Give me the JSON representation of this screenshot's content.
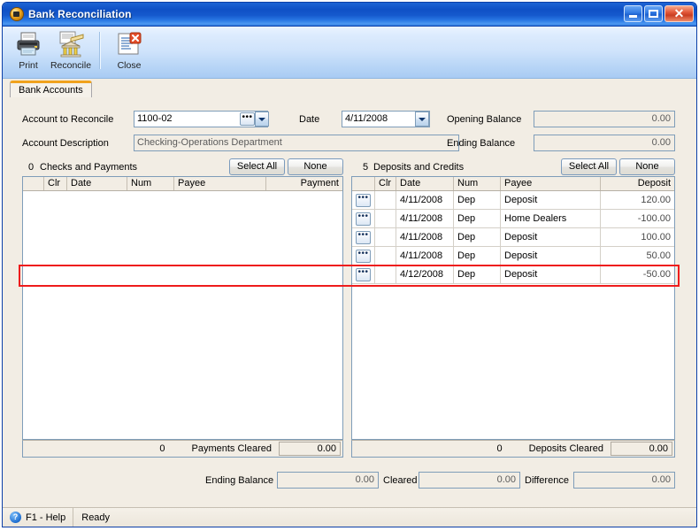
{
  "window": {
    "title": "Bank Reconciliation",
    "icon": "app-icon",
    "minimize_label": "_",
    "maximize_label": "□",
    "close_label": "✕"
  },
  "toolbar": {
    "items": [
      {
        "label": "Print",
        "icon": "printer-icon"
      },
      {
        "label": "Reconcile",
        "icon": "bank-icon"
      },
      {
        "label": "Close",
        "icon": "close-document-icon"
      }
    ]
  },
  "tabs": [
    {
      "label": "Bank Accounts",
      "active": true
    }
  ],
  "form": {
    "account_to_reconcile_label": "Account to Reconcile",
    "account_to_reconcile_value": "1100-02",
    "account_ellipsis_label": "•••",
    "account_description_label": "Account Description",
    "account_description_value": "Checking-Operations Department",
    "date_label": "Date",
    "date_value": "4/11/2008",
    "opening_balance_label": "Opening Balance",
    "opening_balance_value": "0.00",
    "ending_balance_label": "Ending Balance",
    "ending_balance_value": "0.00"
  },
  "left_panel": {
    "count": "0",
    "title": "Checks and Payments",
    "select_all_label": "Select All",
    "none_label": "None",
    "columns": [
      "",
      "Clr",
      "Date",
      "Num",
      "Payee",
      "Payment"
    ],
    "rows": [],
    "footer": {
      "count": "0",
      "label": "Payments Cleared",
      "value": "0.00"
    }
  },
  "right_panel": {
    "count": "5",
    "title": "Deposits and Credits",
    "select_all_label": "Select All",
    "none_label": "None",
    "columns": [
      "",
      "Clr",
      "Date",
      "Num",
      "Payee",
      "Deposit"
    ],
    "rows": [
      {
        "selector": "•••",
        "clr": "",
        "date": "4/11/2008",
        "num": "Dep",
        "payee": "Deposit",
        "amount": "120.00"
      },
      {
        "selector": "•••",
        "clr": "",
        "date": "4/11/2008",
        "num": "Dep",
        "payee": "Home Dealers",
        "amount": "-100.00"
      },
      {
        "selector": "•••",
        "clr": "",
        "date": "4/11/2008",
        "num": "Dep",
        "payee": "Deposit",
        "amount": "100.00"
      },
      {
        "selector": "•••",
        "clr": "",
        "date": "4/11/2008",
        "num": "Dep",
        "payee": "Deposit",
        "amount": "50.00"
      },
      {
        "selector": "•••",
        "clr": "",
        "date": "4/12/2008",
        "num": "Dep",
        "payee": "Deposit",
        "amount": "-50.00"
      }
    ],
    "footer": {
      "count": "0",
      "label": "Deposits Cleared",
      "value": "0.00"
    }
  },
  "totals": {
    "ending_balance_label": "Ending Balance",
    "ending_balance_value": "0.00",
    "cleared_label": "Cleared",
    "cleared_value": "0.00",
    "difference_label": "Difference",
    "difference_value": "0.00"
  },
  "statusbar": {
    "help_label": "F1 - Help",
    "status_label": "Ready"
  },
  "highlight": {
    "color": "#ee1c1c",
    "target": "right-grid-row-5"
  }
}
